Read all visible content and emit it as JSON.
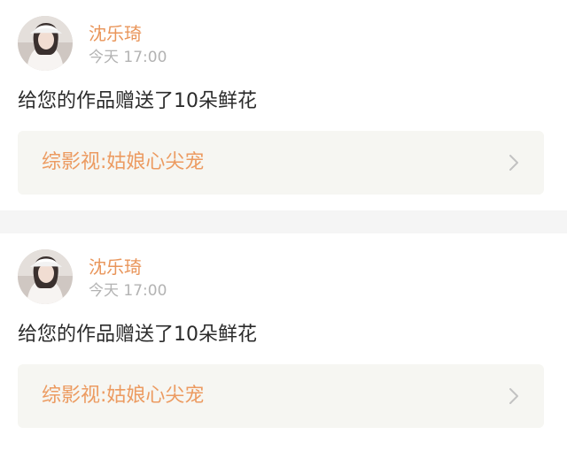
{
  "notifications": [
    {
      "username": "沈乐琦",
      "time": "今天 17:00",
      "message": "给您的作品赠送了10朵鲜花",
      "work_title": "综影视:姑娘心尖宠"
    },
    {
      "username": "沈乐琦",
      "time": "今天 17:00",
      "message": "给您的作品赠送了10朵鲜花",
      "work_title": "综影视:姑娘心尖宠"
    }
  ],
  "icons": {
    "chevron": "chevron-right-icon",
    "avatar": "user-avatar"
  },
  "colors": {
    "username": "#e9955a",
    "work_title": "#ec9b61",
    "link_background": "#f6f6f2",
    "separator": "#f5f5f5",
    "timestamp": "#b3b3b3"
  }
}
